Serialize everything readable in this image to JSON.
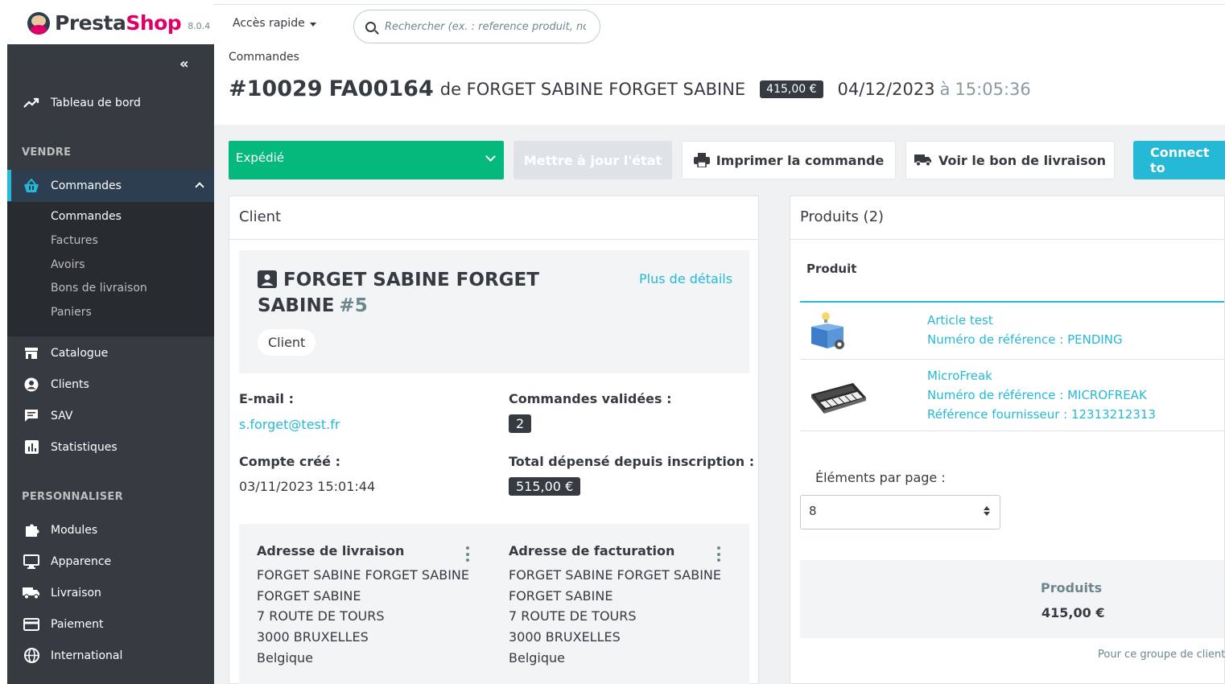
{
  "header": {
    "logo_part1": "Presta",
    "logo_part2": "Shop",
    "version": "8.0.4",
    "quick_access": "Accès rapide",
    "search_placeholder": "Rechercher (ex. : reference produit, no"
  },
  "sidebar": {
    "dashboard": "Tableau de bord",
    "section_sell": "VENDRE",
    "orders": "Commandes",
    "sub_items": [
      "Commandes",
      "Factures",
      "Avoirs",
      "Bons de livraison",
      "Paniers"
    ],
    "catalog": "Catalogue",
    "customers": "Clients",
    "support": "SAV",
    "stats": "Statistiques",
    "section_customize": "PERSONNALISER",
    "modules": "Modules",
    "appearance": "Apparence",
    "shipping": "Livraison",
    "payment": "Paiement",
    "international": "International"
  },
  "page": {
    "breadcrumb": "Commandes",
    "order_number": "#10029",
    "order_reference": "FA00164",
    "customer_prefix": "de FORGET SABINE FORGET SABINE",
    "amount": "415,00 €",
    "date": "04/12/2023",
    "time_prefix": "à",
    "time": "15:05:36"
  },
  "actions": {
    "status": "Expédié",
    "update_status": "Mettre à jour l'état",
    "print_order": "Imprimer la commande",
    "delivery_slip": "Voir le bon de livraison",
    "connect": "Connect to"
  },
  "client_card": {
    "title": "Client",
    "name": "FORGET SABINE FORGET SABINE",
    "customer_id": "#5",
    "more_details": "Plus de détails",
    "badge": "Client",
    "email_label": "E-mail :",
    "email": "s.forget@test.fr",
    "valid_orders_label": "Commandes validées :",
    "valid_orders": "2",
    "created_label": "Compte créé :",
    "created": "03/11/2023 15:01:44",
    "total_spent_label": "Total dépensé depuis inscription :",
    "total_spent": "515,00 €",
    "shipping_address": {
      "title": "Adresse de livraison",
      "lines": [
        "FORGET SABINE FORGET SABINE",
        "FORGET SABINE",
        "7 ROUTE DE TOURS",
        "3000 BRUXELLES",
        "Belgique"
      ]
    },
    "invoice_address": {
      "title": "Adresse de facturation",
      "lines": [
        "FORGET SABINE FORGET SABINE",
        "FORGET SABINE",
        "7 ROUTE DE TOURS",
        "3000 BRUXELLES",
        "Belgique"
      ]
    }
  },
  "products_card": {
    "title": "Produits (2)",
    "column_product": "Produit",
    "products": [
      {
        "name": "Article test",
        "reference": "Numéro de référence : PENDING"
      },
      {
        "name": "MicroFreak",
        "reference": "Numéro de référence : MICROFREAK",
        "supplier_reference": "Référence fournisseur : 12313212313"
      }
    ],
    "per_page_label": "Éléments par page :",
    "per_page_value": "8",
    "totals_label": "Produits",
    "totals_value": "415,00 €",
    "group_note": "Pour ce groupe de clients"
  },
  "colors": {
    "accent": "#25b9d7",
    "success": "#05b97c",
    "sidebar": "#363a41",
    "brand": "#df0067"
  }
}
